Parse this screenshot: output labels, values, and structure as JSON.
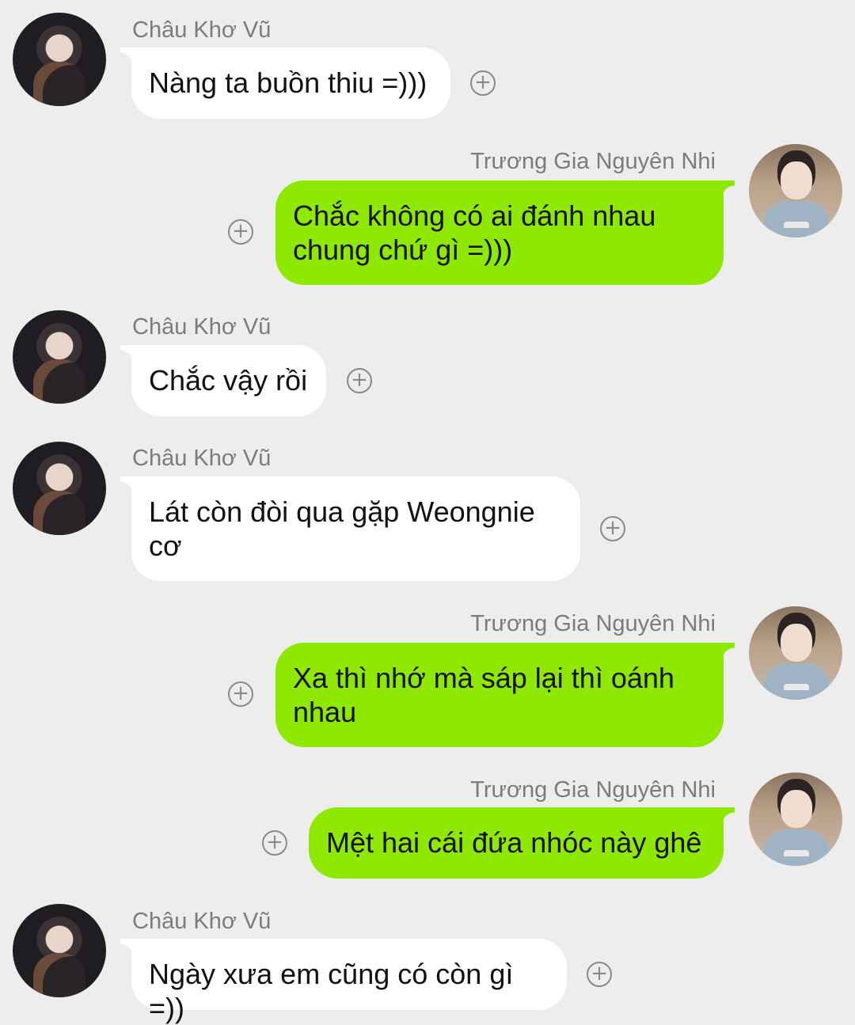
{
  "messages": [
    {
      "side": "left",
      "sender": "Châu Khơ Vũ",
      "text": "Nàng ta buồn thiu =)))"
    },
    {
      "side": "right",
      "sender": "Trương Gia Nguyên Nhi",
      "text": "Chắc không có ai đánh nhau chung chứ gì =)))"
    },
    {
      "side": "left",
      "sender": "Châu Khơ Vũ",
      "text": "Chắc vậy rồi"
    },
    {
      "side": "left",
      "sender": "Châu Khơ Vũ",
      "text": "Lát còn đòi qua gặp Weongnie cơ"
    },
    {
      "side": "right",
      "sender": "Trương Gia Nguyên Nhi",
      "text": "Xa thì nhớ mà sáp lại thì oánh nhau"
    },
    {
      "side": "right",
      "sender": "Trương Gia Nguyên Nhi",
      "text": "Mệt hai cái đứa nhóc này ghê"
    },
    {
      "side": "left",
      "sender": "Châu Khơ Vũ",
      "text": "Ngày xưa em cũng có còn gì =))"
    }
  ],
  "reaction_icon": "plus-circle-icon",
  "colors": {
    "background": "#ededed",
    "incoming_bubble": "#ffffff",
    "outgoing_bubble": "#8fe800",
    "sender_name": "#7c7c7c"
  }
}
